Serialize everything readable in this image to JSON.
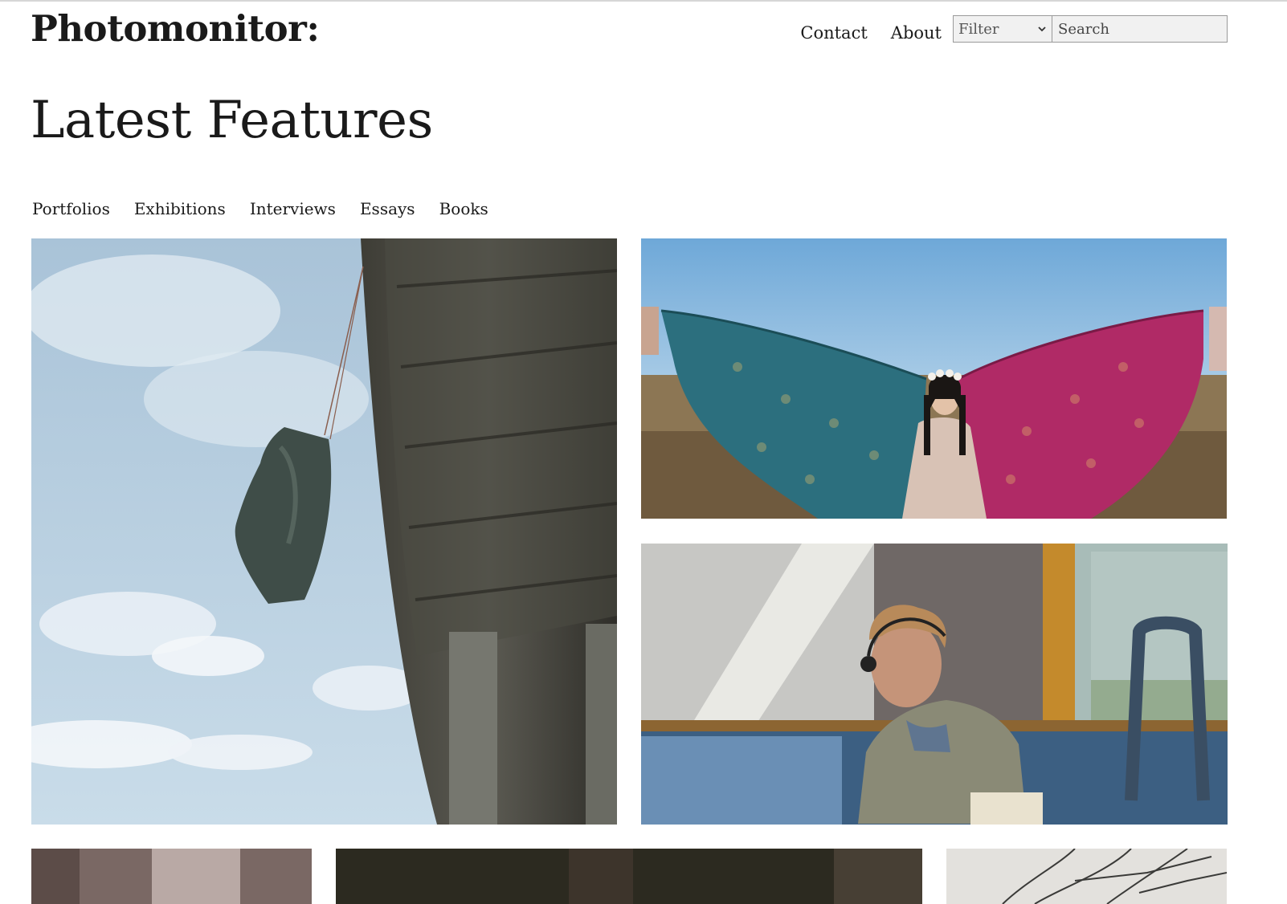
{
  "site": {
    "logo": "Photomonitor:"
  },
  "nav": {
    "contact": "Contact",
    "about": "About",
    "filter": {
      "selected": "Filter"
    },
    "search": {
      "placeholder": "Search"
    }
  },
  "page": {
    "title": "Latest Features"
  },
  "categories": [
    "Portfolios",
    "Exhibitions",
    "Interviews",
    "Essays",
    "Books"
  ],
  "features": [
    {
      "subject": "bag hanging from overpass under cloudy sky"
    },
    {
      "subject": "woman seated between spread patterned fabrics"
    },
    {
      "subject": "young man with headphones reading on a train"
    },
    {
      "subject": "partial image"
    },
    {
      "subject": "partial image"
    },
    {
      "subject": "partial image with bare branches"
    }
  ],
  "colors": {
    "text": "#1a1a1a",
    "input_bg": "#f1f1f1",
    "input_border": "#9a9a9a"
  }
}
